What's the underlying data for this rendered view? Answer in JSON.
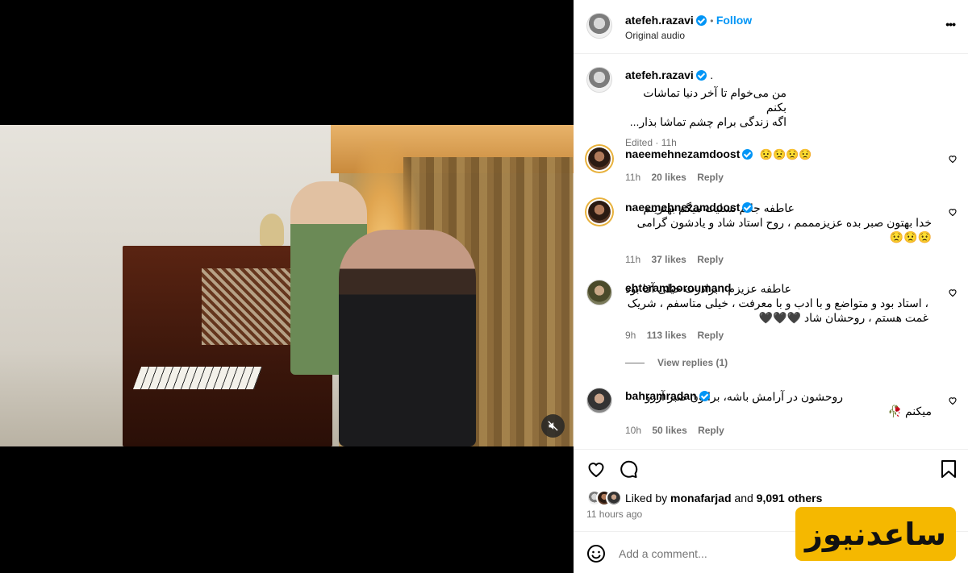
{
  "post": {
    "author": "atefeh.razavi",
    "follow_label": "Follow",
    "audio": "Original audio",
    "more_label": "•••"
  },
  "caption": {
    "author": "atefeh.razavi",
    "dot": ".",
    "line1": "من می‌خوام تا آخر دنیا تماشات بکنم",
    "line2": "اگه زندگی برام چشم تماشا بذار...",
    "meta": "Edited · 11h"
  },
  "comments": [
    {
      "user": "naeemehnezamdoost",
      "text": "😟😟😟😟",
      "time": "11h",
      "likes": "20 likes",
      "reply": "Reply"
    },
    {
      "user": "naeemehnezamdoost",
      "text": "عاطفه جانم تسلیت میگم بهترینم خدا بهتون صبر بده عزیزمممم ، روح استاد شاد و یادشون گرامی 😟😟😟",
      "time": "11h",
      "likes": "37 likes",
      "reply": "Reply"
    },
    {
      "user": "ehteramboroumand",
      "text": "عاطفه عزیزم ، برادرت خیلی آقا بود ، استاد بود و متواضع و با ادب و با معرفت ، خیلی متاسفم ، شریک غمت هستم ، روحشان شاد 🖤🖤🖤",
      "time": "9h",
      "likes": "113 likes",
      "reply": "Reply",
      "view_replies": "View replies (1)"
    },
    {
      "user": "bahramradan",
      "text": "روحشون در آرامش باشه، براتون صبر آرزو میکنم 🥀",
      "time": "10h",
      "likes": "50 likes",
      "reply": "Reply"
    }
  ],
  "likes": {
    "prefix": "Liked by",
    "user": "monafarjad",
    "and": "and",
    "others": "9,091 others",
    "time": "11 hours ago"
  },
  "add_comment": {
    "placeholder": "Add a comment..."
  },
  "watermark": "ساعدنیوز",
  "colors": {
    "accent": "#0095f6",
    "watermark_bg": "#f5b800",
    "meta": "#737373"
  },
  "icons": [
    "verified-badge-icon",
    "more-options-icon",
    "heart-icon",
    "comment-icon",
    "bookmark-icon",
    "emoji-icon",
    "mute-icon"
  ]
}
